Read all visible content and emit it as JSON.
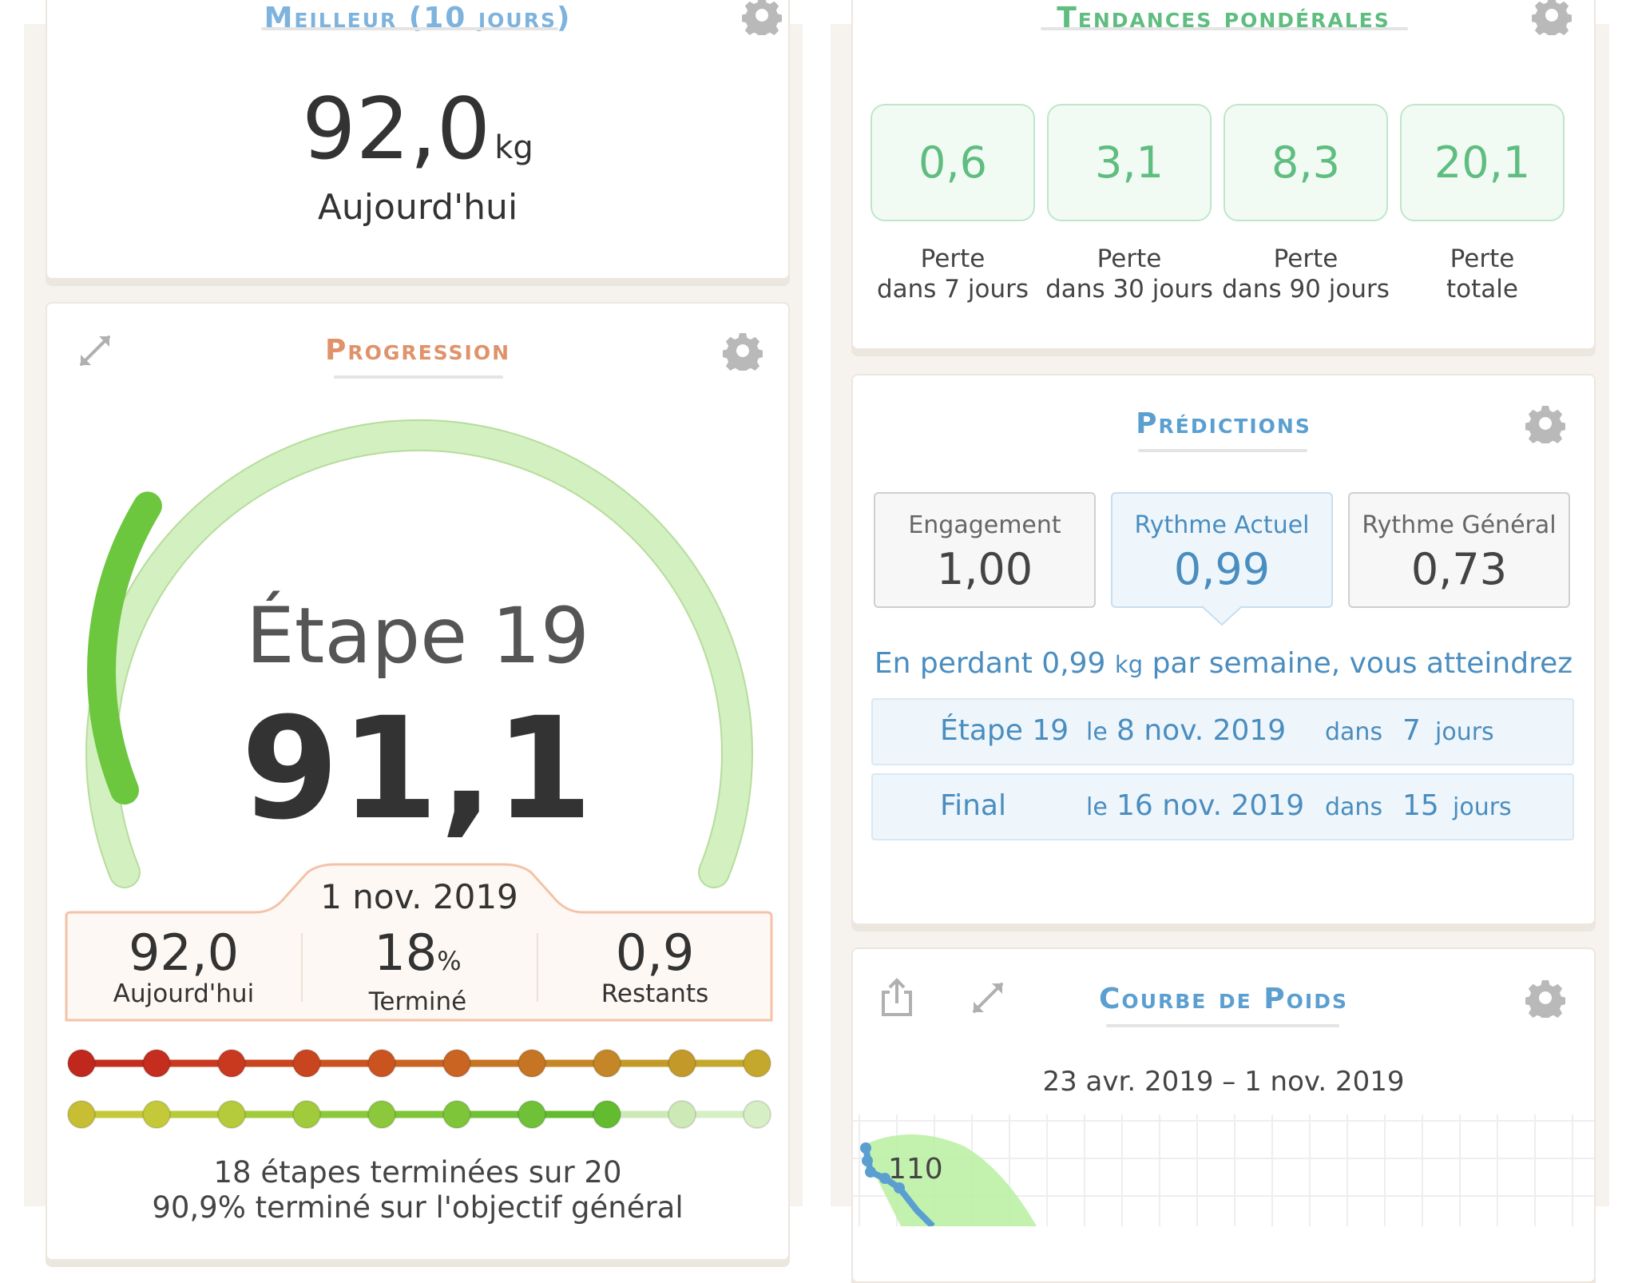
{
  "best_card": {
    "title": "Meilleur (10 jours)",
    "value": "92,0",
    "unit": "kg",
    "caption": "Aujourd'hui"
  },
  "progression": {
    "title": "Progression",
    "step_label": "Étape 19",
    "value": "91,1",
    "date": "1 nov. 2019",
    "gauge_progress": 0.18,
    "stats": [
      {
        "value": "92,0",
        "suffix": "",
        "label": "Aujourd'hui"
      },
      {
        "value": "18",
        "suffix": "%",
        "label": "Terminé"
      },
      {
        "value": "0,9",
        "suffix": "",
        "label": "Restants"
      }
    ],
    "steps_summary": "18 étapes terminées sur 20",
    "overall_summary": "90,9% terminé sur l'objectif général",
    "colors": {
      "gauge_track": "#d3f0c0",
      "gauge_fill": "#6cc63e",
      "title": "#e0926a"
    }
  },
  "steps_rows": {
    "row1_colors": [
      "#c0281e",
      "#c52d1e",
      "#c8391f",
      "#c9451f",
      "#ca5420",
      "#c96422",
      "#c67524",
      "#c48626",
      "#c39a29",
      "#c4a82c"
    ],
    "row2_colors": [
      "#c7be34",
      "#c4c93a",
      "#b5cb3b",
      "#a1cb3b",
      "#8bc83b",
      "#7ec53a",
      "#6fc238",
      "#63bc2f",
      "#cdeab6",
      "#d6efc5"
    ],
    "completed_in_row2": 8
  },
  "trends": {
    "title": "Tendances pondérales",
    "items": [
      {
        "value": "0,6",
        "label_line1": "Perte",
        "label_line2": "dans 7 jours"
      },
      {
        "value": "3,1",
        "label_line1": "Perte",
        "label_line2": "dans 30 jours"
      },
      {
        "value": "8,3",
        "label_line1": "Perte",
        "label_line2": "dans 90 jours"
      },
      {
        "value": "20,1",
        "label_line1": "Perte",
        "label_line2": "totale"
      }
    ]
  },
  "predictions": {
    "title": "Prédictions",
    "boxes": [
      {
        "label": "Engagement",
        "value": "1,00"
      },
      {
        "label": "Rythme Actuel",
        "value": "0,99"
      },
      {
        "label": "Rythme Général",
        "value": "0,73"
      }
    ],
    "sentence_pre": "En perdant 0,99",
    "sentence_unit": "kg",
    "sentence_post": "par semaine, vous atteindrez",
    "rows": [
      {
        "name": "Étape 19",
        "le": "le",
        "date": "8 nov. 2019",
        "dans": "dans",
        "days": "7",
        "jours": "jours"
      },
      {
        "name": "Final",
        "le": "le",
        "date": "16 nov. 2019",
        "dans": "dans",
        "days": "15",
        "jours": "jours"
      }
    ]
  },
  "weight_curve": {
    "title": "Courbe de Poids",
    "range": "23 avr. 2019 – 1 nov. 2019",
    "y_label_visible": "110"
  }
}
